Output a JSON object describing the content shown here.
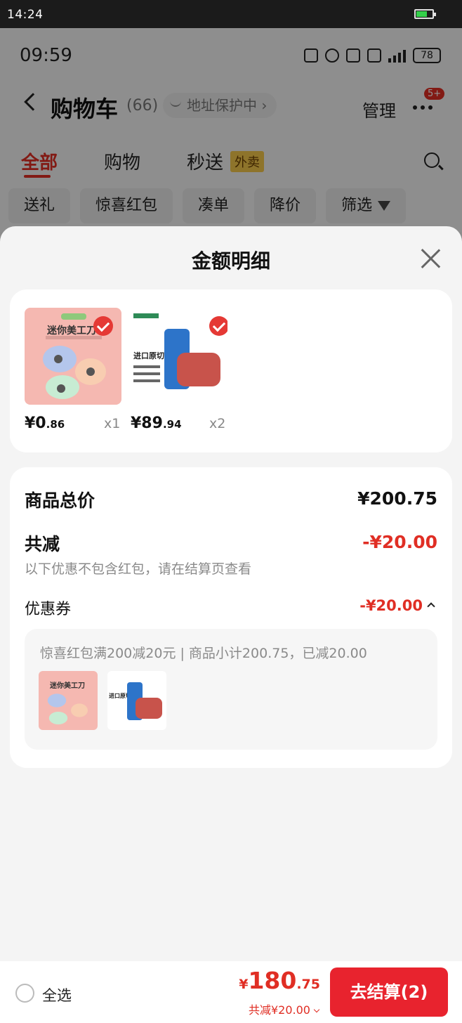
{
  "device_status": {
    "time": "14:24"
  },
  "background_app": {
    "status": {
      "time": "09:59",
      "battery": "78"
    },
    "header": {
      "title": "购物车",
      "count": "(66)",
      "address_badge": "地址保护中 ›",
      "manage": "管理",
      "badge": "5+"
    },
    "tabs": [
      {
        "label": "全部"
      },
      {
        "label": "购物"
      },
      {
        "label": "秒送",
        "tag": "外卖"
      }
    ],
    "filters": [
      "送礼",
      "惊喜红包",
      "凑单",
      "降价",
      "筛选"
    ]
  },
  "sheet": {
    "title": "金额明细",
    "products": [
      {
        "image_title": "迷你美工刀",
        "price_int": "¥0",
        "price_dec": ".86",
        "qty": "x1"
      },
      {
        "image_title": "进口原切",
        "price_int": "¥89",
        "price_dec": ".94",
        "qty": "x2"
      }
    ],
    "summary": {
      "total_label": "商品总价",
      "total_value": "¥200.75",
      "discount_label": "共减",
      "discount_value": "-¥20.00",
      "note": "以下优惠不包含红包，请在结算页查看",
      "coupon_label": "优惠券",
      "coupon_value": "-¥20.00",
      "coupon_detail": "惊喜红包满200减20元 | 商品小计200.75，已减20.00",
      "thumb_titles": [
        "迷你美工刀",
        "进口原切"
      ]
    }
  },
  "bottom_bar": {
    "select_all": "全选",
    "yen": "¥",
    "total_int": "180",
    "total_dec": ".75",
    "saved": "共减¥20.00",
    "checkout": "去结算(2)"
  },
  "colors": {
    "accent": "#e02e24",
    "checkout_bg": "#e8232e"
  }
}
